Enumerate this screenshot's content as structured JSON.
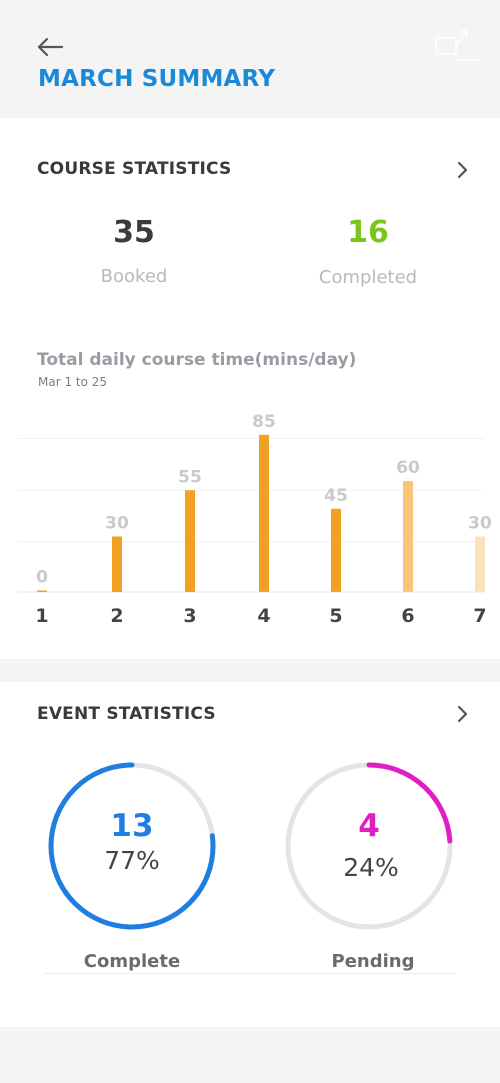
{
  "header": {
    "title": "MARCH SUMMARY",
    "back_icon": "arrow-left-icon",
    "share_icon": "share-icon"
  },
  "course_stats": {
    "title": "COURSE STATISTICS",
    "booked_value": "35",
    "booked_label": "Booked",
    "completed_value": "16",
    "completed_label": "Completed"
  },
  "chart": {
    "title": "Total daily course time(mins/day)",
    "subtitle": "Mar 1 to 25"
  },
  "chart_data": {
    "type": "bar",
    "categories": [
      "1",
      "2",
      "3",
      "4",
      "5",
      "6",
      "7"
    ],
    "values": [
      0,
      30,
      55,
      85,
      45,
      60,
      30
    ],
    "ylim": [
      0,
      100
    ],
    "grid": true,
    "colors": [
      "#f2a122",
      "#f2a122",
      "#f2a122",
      "#f2a122",
      "#f2a122",
      "#f8c576",
      "#fae3bb"
    ]
  },
  "event_stats": {
    "title": "EVENT STATISTICS",
    "complete": {
      "value": "13",
      "percent": "77%",
      "label": "Complete",
      "fraction": 0.77,
      "color": "#1f7ee0"
    },
    "pending": {
      "value": "4",
      "percent": "24%",
      "label": "Pending",
      "fraction": 0.24,
      "color": "#e01ec4"
    }
  },
  "colors": {
    "accent": "#1a8ad8",
    "completed_green": "#7bc61c",
    "bar_orange": "#f2a122"
  }
}
